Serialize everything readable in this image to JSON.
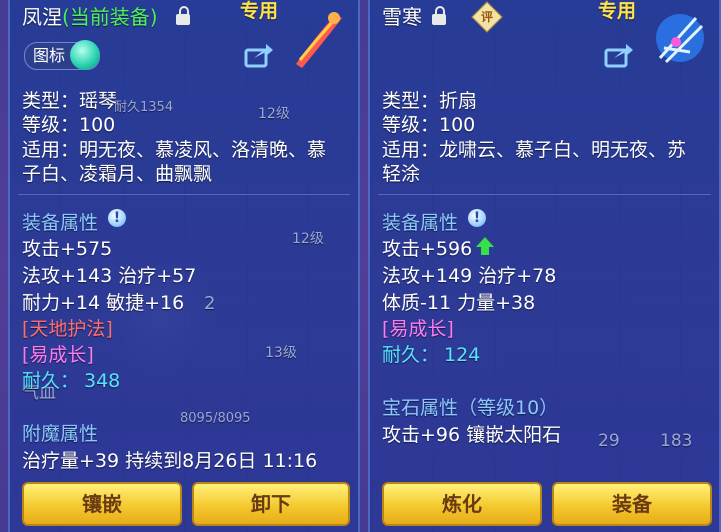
{
  "left": {
    "name": "凤涅",
    "current_equipped": "(当前装备)",
    "exclusive": "专用",
    "badge_label": "图标",
    "type": "类型：瑶琴",
    "level": "等级：100",
    "applies_line1": "适用：明无夜、慕凌风、洛清晚、慕",
    "applies_line2": "子白、凌霜月、曲飘飘",
    "attr_title": "装备属性",
    "attack": "攻击+575",
    "magic_heal": "法攻+143 治疗+57",
    "stamina_agility": "耐力+14 敏捷+16",
    "skill": "[天地护法]",
    "growth": "[易成长]",
    "durability_label": "耐久：",
    "durability_value": "348",
    "enchant_title": "附魔属性",
    "enchant_effect": "治疗量+39 持续到8月26日 11:16",
    "btn_inlay": "镶嵌",
    "btn_unequip": "卸下",
    "bg_durability": "耐久1354",
    "bg_level12a": "12级",
    "bg_level12b": "12级",
    "bg_level13": "13级",
    "bg_qixue": "气血",
    "bg_hp": "8095/8095",
    "bg_two": "2"
  },
  "right": {
    "name": "雪寒",
    "exclusive": "专用",
    "rate_label": "评",
    "type": "类型：折扇",
    "level": "等级：100",
    "applies_line1": "适用：龙啸云、慕子白、明无夜、苏",
    "applies_line2": "轻涂",
    "attr_title": "装备属性",
    "attack": "攻击+596",
    "magic_heal": "法攻+149 治疗+78",
    "physique_strength": "体质-11 力量+38",
    "growth": "[易成长]",
    "durability_label": "耐久：",
    "durability_value": "124",
    "gem_title": "宝石属性（等级10）",
    "gem_effect": "攻击+96 镶嵌太阳石",
    "btn_refine": "炼化",
    "btn_equip": "装备",
    "bg_29": "29",
    "bg_183": "183"
  },
  "colors": {
    "name_white": "#ffffff",
    "equipped_green": "#4eef5a",
    "exclusive_yellow": "#ffe24a",
    "section_blue": "#89c9ff",
    "skill_red": "#ff6e6e",
    "growth_purple": "#ff7cf0",
    "durability_cyan": "#56e4ff",
    "button_gold": "#f4c92f"
  }
}
